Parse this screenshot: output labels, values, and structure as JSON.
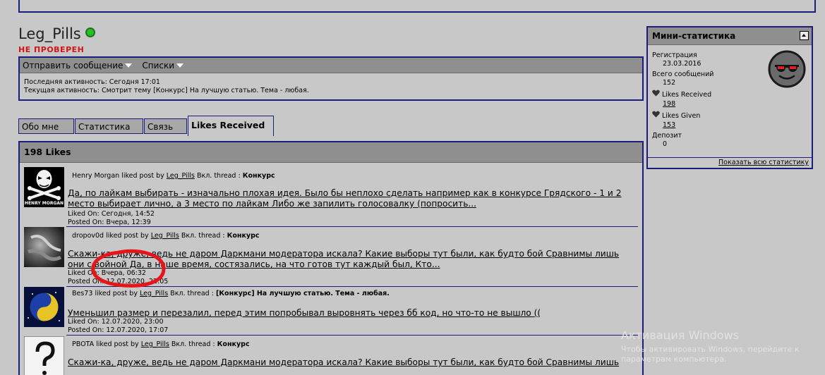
{
  "profile": {
    "username": "Leg_Pills",
    "status": "НЕ ПРОВЕРЕН",
    "status_color": "#d41414",
    "online_color": "#21c321"
  },
  "actions": {
    "send_message": "Отправить сообщение",
    "lists": "Списки"
  },
  "activity": {
    "last": "Последняя активность: Сегодня 17:01",
    "current": "Текущая активность: Смотрит тему [Конкурс] На лучшую статью. Тема - любая."
  },
  "tabs": [
    {
      "label": "Обо мне"
    },
    {
      "label": "Статистика"
    },
    {
      "label": "Связь"
    },
    {
      "label": "Likes Received"
    }
  ],
  "likes": {
    "header": "198 Likes",
    "entries": [
      {
        "user": "Henry Morgan",
        "liked_text": "liked post by",
        "author": "Leg_Pills",
        "in_thread": "Вкл. thread :",
        "thread": "Конкурс",
        "post_line1": "Да, по лайкам выбирать - изначально плохая идея. Было бы неплохо сделать например как в конкурсе Грядского - 1 и 2",
        "post_line2": "место выбирает лично, а 3 место по лайкам Либо же запилить голосовалку (попросить...",
        "liked_on": "Liked On: Сегодня, 14:52",
        "posted_on": "Posted On: Вчера, 12:39",
        "avatar_text": "HENRY MORGAN"
      },
      {
        "user": "dropov0d",
        "liked_text": "liked post by",
        "author": "Leg_Pills",
        "in_thread": "Вкл. thread :",
        "thread": "Конкурс",
        "post_line1": "Скажи-ка, друже, ведь не даром Даркмани модератора искала? Какие выборы тут были, как будто бой Сравнимы лишь",
        "post_line2": "они с войной Да, в наше время, состязались, на что готов тут каждый был, Кто...",
        "liked_on": "Liked On: Вчера, 06:32",
        "posted_on": "Posted On: 12.07.2020, 22:05"
      },
      {
        "user": "Bes73",
        "liked_text": "liked post by",
        "author": "Leg_Pills",
        "in_thread": "Вкл. thread :",
        "thread": "[Конкурс] На лучшую статью. Тема - любая.",
        "post_line1": "Уменьшил размер и перезалил, перед этим попробывал выровнять через бб код, но что-то не вышло ((",
        "post_line2": "",
        "liked_on": "Liked On: 12.07.2020, 23:00",
        "posted_on": "Posted On: 12.07.2020, 17:07"
      },
      {
        "user": "PBOTA",
        "liked_text": "liked post by",
        "author": "Leg_Pills",
        "in_thread": "Вкл. thread :",
        "thread": "Конкурс",
        "post_line1": "Скажи-ка, друже, ведь не даром Даркмани модератора искала? Какие выборы тут были, как будто бой Сравнимы лишь",
        "post_line2": "",
        "liked_on": "",
        "posted_on": ""
      }
    ]
  },
  "stats": {
    "title": "Мини-статистика",
    "reg_label": "Регистрация",
    "reg_value": "23.03.2016",
    "posts_label": "Всего сообщений",
    "posts_value": "152",
    "likes_received_label": "Likes Received",
    "likes_received_value": "198",
    "likes_given_label": "Likes Given",
    "likes_given_value": "153",
    "deposit_label": "Депозит",
    "deposit_value": "0",
    "show_all": "Показать всю статистику"
  },
  "watermark": {
    "title": "Активация Windows",
    "line1": "Чтобы активировать Windows, перейдите к",
    "line2": "параметрам компьютера."
  }
}
